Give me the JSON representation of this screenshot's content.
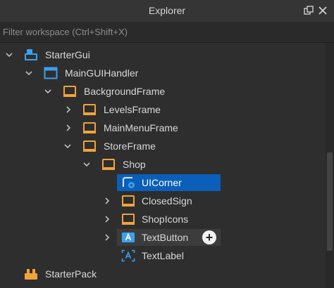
{
  "window": {
    "title": "Explorer",
    "float_icon": "float-window-icon",
    "close_icon": "close-icon"
  },
  "filter": {
    "placeholder": "Filter workspace (Ctrl+Shift+X)",
    "value": ""
  },
  "tree": {
    "items": [
      {
        "label": "StarterGui",
        "icon": "starter-gui-icon",
        "expanded": true
      },
      {
        "label": "MainGUIHandler",
        "icon": "screen-gui-icon",
        "expanded": true
      },
      {
        "label": "BackgroundFrame",
        "icon": "frame-icon",
        "expanded": true
      },
      {
        "label": "LevelsFrame",
        "icon": "frame-icon",
        "expanded": false
      },
      {
        "label": "MainMenuFrame",
        "icon": "frame-icon",
        "expanded": false
      },
      {
        "label": "StoreFrame",
        "icon": "frame-icon",
        "expanded": true
      },
      {
        "label": "Shop",
        "icon": "frame-icon",
        "expanded": true
      },
      {
        "label": "UICorner",
        "icon": "ui-corner-icon",
        "selected": true
      },
      {
        "label": "ClosedSign",
        "icon": "frame-icon",
        "expanded": false
      },
      {
        "label": "ShopIcons",
        "icon": "frame-icon",
        "expanded": false
      },
      {
        "label": "TextButton",
        "icon": "text-button-icon",
        "expanded": false,
        "hovered": true
      },
      {
        "label": "TextLabel",
        "icon": "text-label-icon"
      },
      {
        "label": "StarterPack",
        "icon": "starter-pack-icon"
      }
    ]
  },
  "colors": {
    "selection": "#0b5fb8",
    "frame_icon": "#f0a43a",
    "accent_blue": "#3aa0f0"
  }
}
